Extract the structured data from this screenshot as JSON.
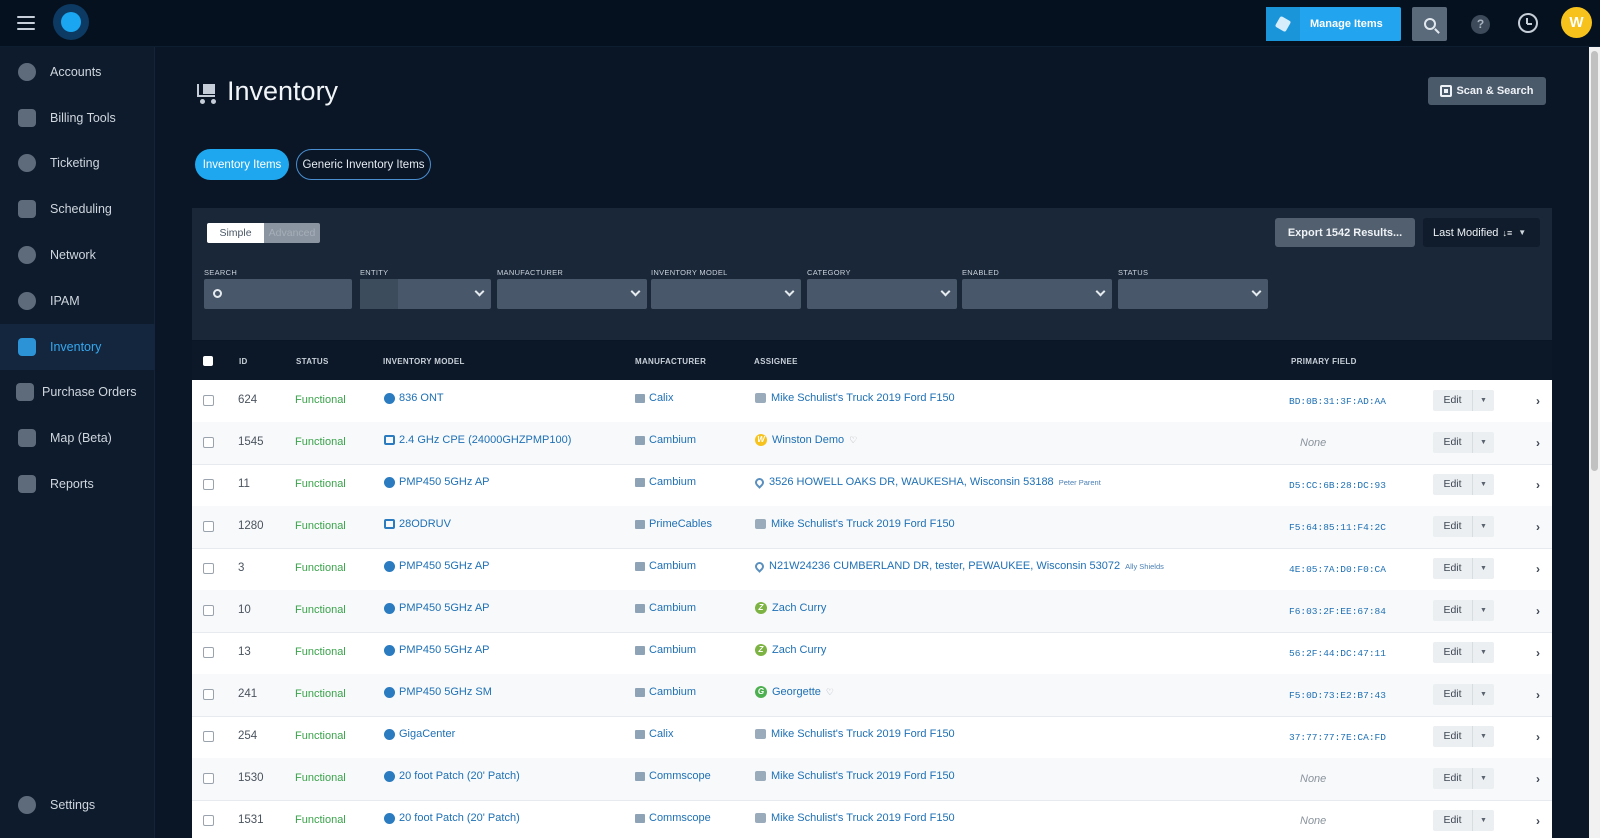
{
  "topbar": {
    "manage_items_label": "Manage Items",
    "help_label": "?",
    "user_initial": "W"
  },
  "sidebar": {
    "items": [
      {
        "label": "Accounts",
        "icon": "user-circle-icon"
      },
      {
        "label": "Billing Tools",
        "icon": "calculator-icon"
      },
      {
        "label": "Ticketing",
        "icon": "chat-bubble-icon"
      },
      {
        "label": "Scheduling",
        "icon": "calendar-icon"
      },
      {
        "label": "Network",
        "icon": "network-icon"
      },
      {
        "label": "IPAM",
        "icon": "ipam-icon"
      },
      {
        "label": "Inventory",
        "icon": "cart-icon",
        "active": true
      },
      {
        "label": "Purchase Orders",
        "icon": "purchase-order-icon"
      },
      {
        "label": "Map (Beta)",
        "icon": "map-icon"
      },
      {
        "label": "Reports",
        "icon": "report-icon"
      }
    ],
    "settings_label": "Settings"
  },
  "page": {
    "title": "Inventory",
    "scan_search_label": "Scan & Search",
    "tabs": [
      {
        "label": "Inventory Items",
        "active": true
      },
      {
        "label": "Generic Inventory Items",
        "active": false
      }
    ]
  },
  "filters": {
    "mode_simple": "Simple",
    "mode_advanced": "Advanced",
    "export_label": "Export 1542 Results...",
    "sort_label": "Last Modified",
    "sort_icon": "↓≡",
    "labels": {
      "search": "SEARCH",
      "entity": "ENTITY",
      "manufacturer": "MANUFACTURER",
      "inventory_model": "INVENTORY MODEL",
      "category": "CATEGORY",
      "enabled": "ENABLED",
      "status": "STATUS"
    }
  },
  "table": {
    "headers": {
      "id": "ID",
      "status": "STATUS",
      "model": "INVENTORY MODEL",
      "manufacturer": "MANUFACTURER",
      "assignee": "ASSIGNEE",
      "primary": "PRIMARY FIELD"
    },
    "edit_label": "Edit",
    "rows": [
      {
        "id": "624",
        "status": "Functional",
        "model": "836 ONT",
        "manufacturer": "Calix",
        "assignee": "Mike Schulist's Truck 2019 Ford F150",
        "assignee_sub": "",
        "primary": "BD:0B:31:3F:AD:AA"
      },
      {
        "id": "1545",
        "status": "Functional",
        "model": "2.4 GHz CPE (24000GHZPMP100)",
        "manufacturer": "Cambium",
        "assignee": "Winston Demo",
        "assignee_sub": "",
        "primary": "None"
      },
      {
        "id": "11",
        "status": "Functional",
        "model": "PMP450 5GHz AP",
        "manufacturer": "Cambium",
        "assignee": "3526 HOWELL OAKS DR, WAUKESHA, Wisconsin 53188",
        "assignee_sub": "Peter Parent",
        "primary": "D5:CC:6B:28:DC:93"
      },
      {
        "id": "1280",
        "status": "Functional",
        "model": "28ODRUV",
        "manufacturer": "PrimeCables",
        "assignee": "Mike Schulist's Truck 2019 Ford F150",
        "assignee_sub": "",
        "primary": "F5:64:85:11:F4:2C"
      },
      {
        "id": "3",
        "status": "Functional",
        "model": "PMP450 5GHz AP",
        "manufacturer": "Cambium",
        "assignee": "N21W24236 CUMBERLAND DR, tester, PEWAUKEE, Wisconsin 53072",
        "assignee_sub": "Ally Shields",
        "primary": "4E:05:7A:D0:F0:CA"
      },
      {
        "id": "10",
        "status": "Functional",
        "model": "PMP450 5GHz AP",
        "manufacturer": "Cambium",
        "assignee": "Zach Curry",
        "assignee_sub": "",
        "primary": "F6:03:2F:EE:67:84"
      },
      {
        "id": "13",
        "status": "Functional",
        "model": "PMP450 5GHz AP",
        "manufacturer": "Cambium",
        "assignee": "Zach Curry",
        "assignee_sub": "",
        "primary": "56:2F:44:DC:47:11"
      },
      {
        "id": "241",
        "status": "Functional",
        "model": "PMP450 5GHz SM",
        "manufacturer": "Cambium",
        "assignee": "Georgette",
        "assignee_sub": "",
        "primary": "F5:0D:73:E2:B7:43"
      },
      {
        "id": "254",
        "status": "Functional",
        "model": "GigaCenter",
        "manufacturer": "Calix",
        "assignee": "Mike Schulist's Truck 2019 Ford F150",
        "assignee_sub": "",
        "primary": "37:77:77:7E:CA:FD"
      },
      {
        "id": "1530",
        "status": "Functional",
        "model": "20 foot Patch (20' Patch)",
        "manufacturer": "Commscope",
        "assignee": "Mike Schulist's Truck 2019 Ford F150",
        "assignee_sub": "",
        "primary": "None"
      },
      {
        "id": "1531",
        "status": "Functional",
        "model": "20 foot Patch (20' Patch)",
        "manufacturer": "Commscope",
        "assignee": "Mike Schulist's Truck 2019 Ford F150",
        "assignee_sub": "",
        "primary": "None"
      }
    ]
  },
  "colors": {
    "accent": "#22a4ee",
    "status_functional": "#3aa34b",
    "link": "#1e70b5",
    "avatar_yellow": "#f6c21b",
    "avatar_green": "#4cb050"
  }
}
